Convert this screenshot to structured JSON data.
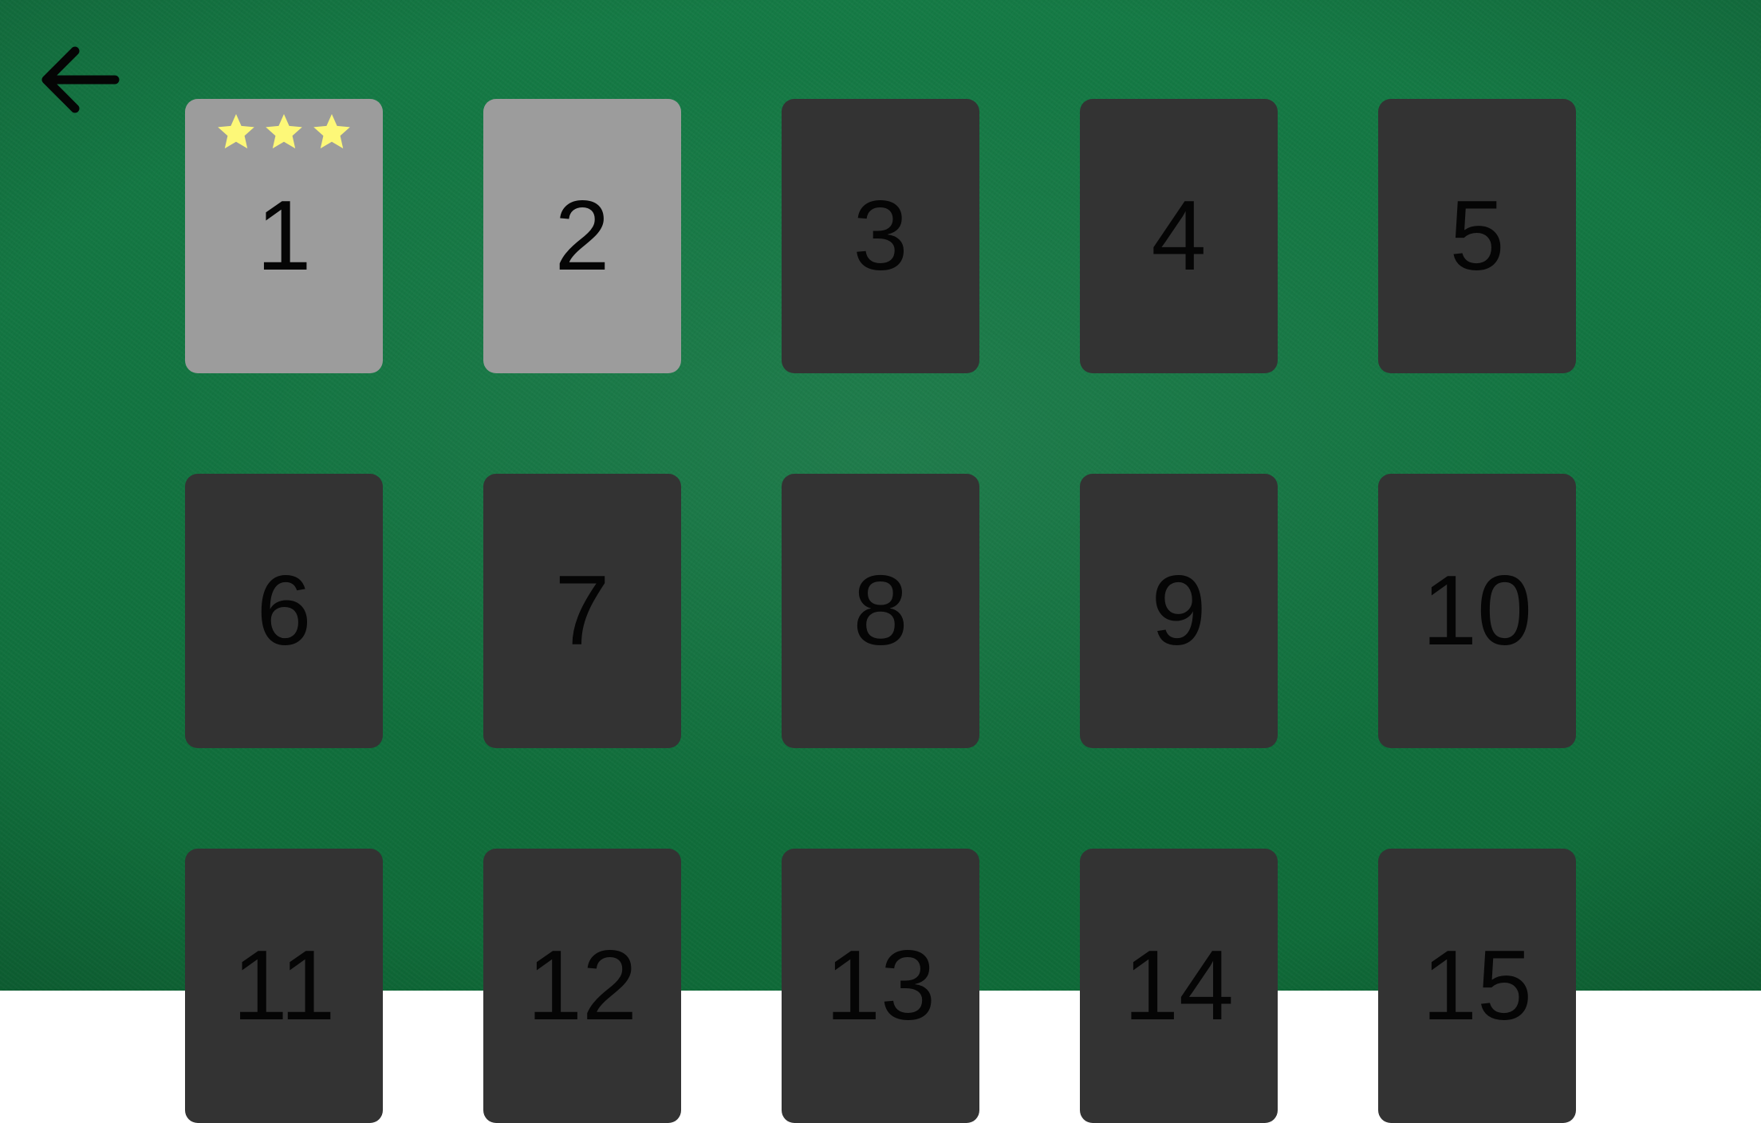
{
  "colors": {
    "felt": "#127340",
    "card_locked": "#333333",
    "card_unlocked": "#9c9c9c",
    "star": "#fdf878",
    "number": "#050505",
    "back_arrow": "#050505"
  },
  "back_button": {
    "icon": "arrow-left-icon"
  },
  "levels": [
    {
      "number": "1",
      "unlocked": true,
      "stars": 3
    },
    {
      "number": "2",
      "unlocked": true,
      "stars": 0
    },
    {
      "number": "3",
      "unlocked": false,
      "stars": 0
    },
    {
      "number": "4",
      "unlocked": false,
      "stars": 0
    },
    {
      "number": "5",
      "unlocked": false,
      "stars": 0
    },
    {
      "number": "6",
      "unlocked": false,
      "stars": 0
    },
    {
      "number": "7",
      "unlocked": false,
      "stars": 0
    },
    {
      "number": "8",
      "unlocked": false,
      "stars": 0
    },
    {
      "number": "9",
      "unlocked": false,
      "stars": 0
    },
    {
      "number": "10",
      "unlocked": false,
      "stars": 0
    },
    {
      "number": "11",
      "unlocked": false,
      "stars": 0
    },
    {
      "number": "12",
      "unlocked": false,
      "stars": 0
    },
    {
      "number": "13",
      "unlocked": false,
      "stars": 0
    },
    {
      "number": "14",
      "unlocked": false,
      "stars": 0
    },
    {
      "number": "15",
      "unlocked": false,
      "stars": 0
    }
  ]
}
